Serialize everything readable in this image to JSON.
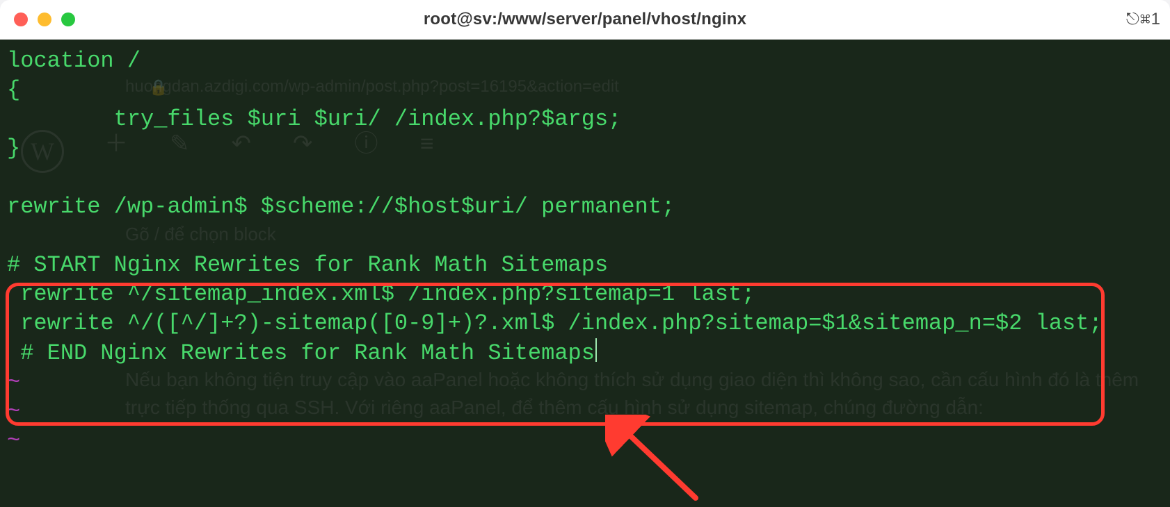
{
  "titlebar": {
    "title": "root@sv:/www/server/panel/vhost/nginx",
    "right_indicator": "⎋⌘1"
  },
  "background_ghost": {
    "url_line": "huongdan.azdigi.com/wp-admin/post.php?post=16195&action=edit",
    "prompt_line": "Gõ / để chọn block",
    "paragraph": "Nếu bạn không tiện truy cập vào aaPanel hoặc không thích sử dụng giao diện thì không sao, cần cấu hình đó là thêm trực tiếp thống qua SSH. Với riêng aaPanel, để thêm cấu hình sử dụng sitemap, chúng đường dẫn:"
  },
  "terminal": {
    "lines": [
      "location /",
      "{",
      "        try_files $uri $uri/ /index.php?$args;",
      "}",
      "",
      "rewrite /wp-admin$ $scheme://$host$uri/ permanent;",
      "",
      "# START Nginx Rewrites for Rank Math Sitemaps",
      " rewrite ^/sitemap_index.xml$ /index.php?sitemap=1 last;",
      " rewrite ^/([^/]+?)-sitemap([0-9]+)?.xml$ /index.php?sitemap=$1&sitemap_n=$2 last;",
      " # END Nginx Rewrites for Rank Math Sitemaps"
    ],
    "tilde_lines": 3,
    "tilde_char": "~"
  },
  "annotations": {
    "arrow_color": "#ff3b30",
    "box_color": "#ff3b30"
  }
}
